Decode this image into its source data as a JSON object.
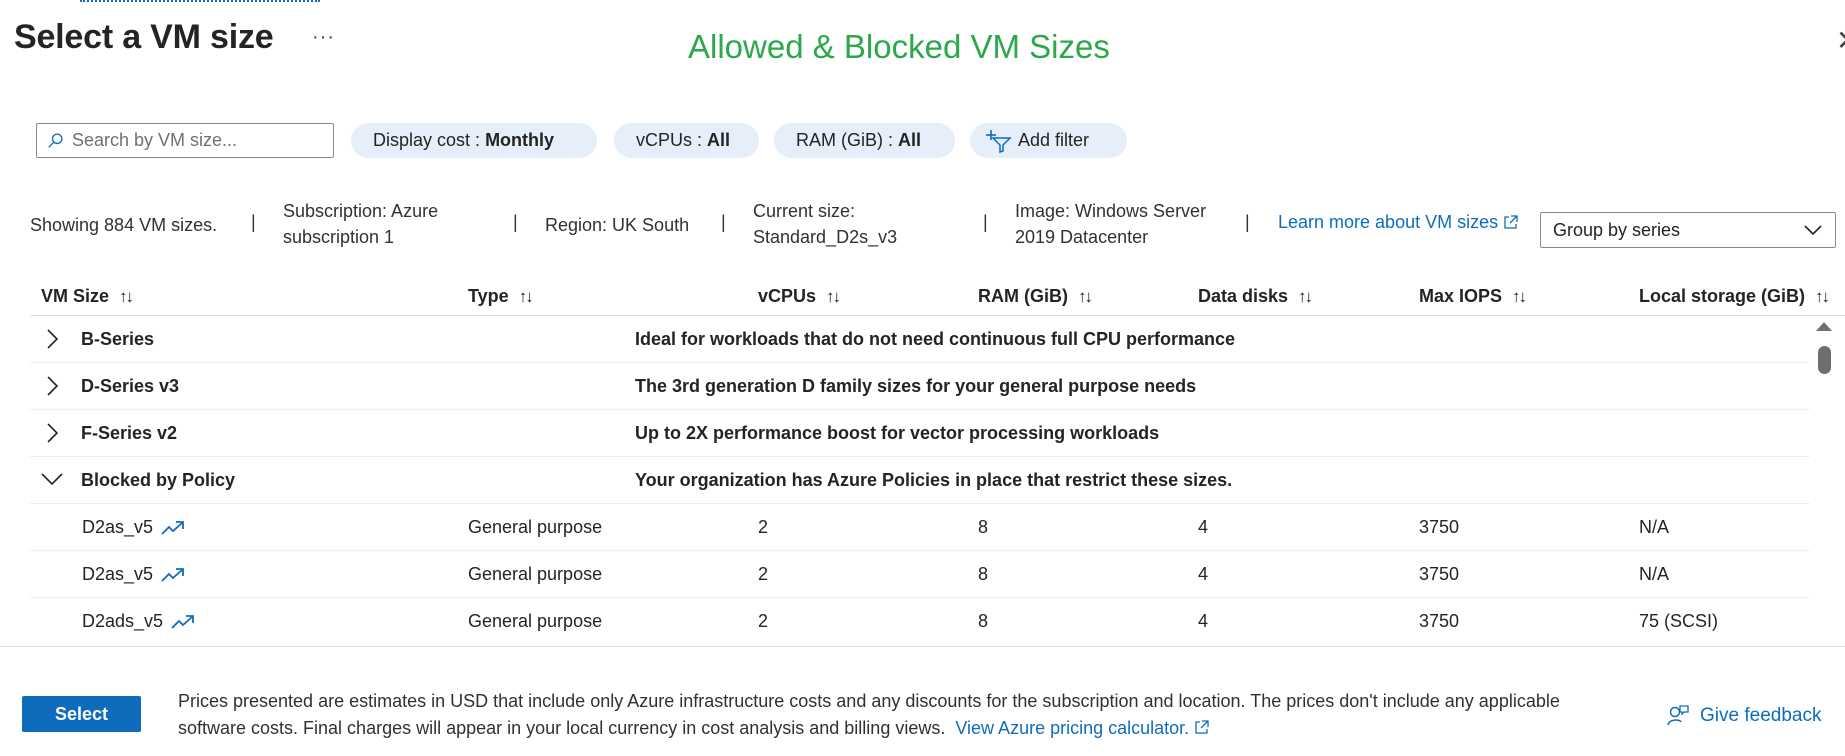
{
  "header": {
    "title": "Select a VM size",
    "more_label": "···",
    "overlay_title": "Allowed & Blocked VM Sizes"
  },
  "filters": {
    "search_placeholder": "Search by VM size...",
    "display_cost_label": "Display cost :",
    "display_cost_value": "Monthly",
    "vcpus_label": "vCPUs :",
    "vcpus_value": "All",
    "ram_label": "RAM (GiB) :",
    "ram_value": "All",
    "add_filter_label": "Add filter"
  },
  "summary": {
    "showing": "Showing 884 VM sizes.",
    "subscription_line1": "Subscription: Azure",
    "subscription_line2": "subscription 1",
    "region": "Region: UK South",
    "current_size_line1": "Current size:",
    "current_size_line2": "Standard_D2s_v3",
    "image_line1": "Image: Windows Server",
    "image_line2": "2019 Datacenter",
    "separator": "|",
    "learn_more": "Learn more about VM sizes",
    "group_by": "Group by series"
  },
  "table": {
    "sort_glyph": "↑↓",
    "columns": [
      "VM Size",
      "Type",
      "vCPUs",
      "RAM (GiB)",
      "Data disks",
      "Max IOPS",
      "Local storage (GiB)"
    ],
    "groups": [
      {
        "name": "B-Series",
        "description": "Ideal for workloads that do not need continuous full CPU performance",
        "expanded": false
      },
      {
        "name": "D-Series v3",
        "description": "The 3rd generation D family sizes for your general purpose needs",
        "expanded": false
      },
      {
        "name": "F-Series v2",
        "description": "Up to 2X performance boost for vector processing workloads",
        "expanded": false
      },
      {
        "name": "Blocked by Policy",
        "description": "Your organization has Azure Policies in place that restrict these sizes.",
        "expanded": true
      }
    ],
    "rows": [
      {
        "size": "D2as_v5",
        "type": "General purpose",
        "vcpus": "2",
        "ram": "8",
        "data_disks": "4",
        "max_iops": "3750",
        "local_storage": "N/A"
      },
      {
        "size": "D2as_v5",
        "type": "General purpose",
        "vcpus": "2",
        "ram": "8",
        "data_disks": "4",
        "max_iops": "3750",
        "local_storage": "N/A"
      },
      {
        "size": "D2ads_v5",
        "type": "General purpose",
        "vcpus": "2",
        "ram": "8",
        "data_disks": "4",
        "max_iops": "3750",
        "local_storage": "75 (SCSI)"
      }
    ]
  },
  "footer": {
    "select_label": "Select",
    "note": "Prices presented are estimates in USD that include only Azure infrastructure costs and any discounts for the subscription and location. The prices don't include any applicable software costs. Final charges will appear in your local currency in cost analysis and billing views.",
    "pricing_link": "View Azure pricing calculator.",
    "feedback_label": "Give feedback"
  },
  "colors": {
    "accent": "#0f6cbd",
    "overlay_title": "#2aa84a",
    "pill_bg": "#e6eef9"
  }
}
